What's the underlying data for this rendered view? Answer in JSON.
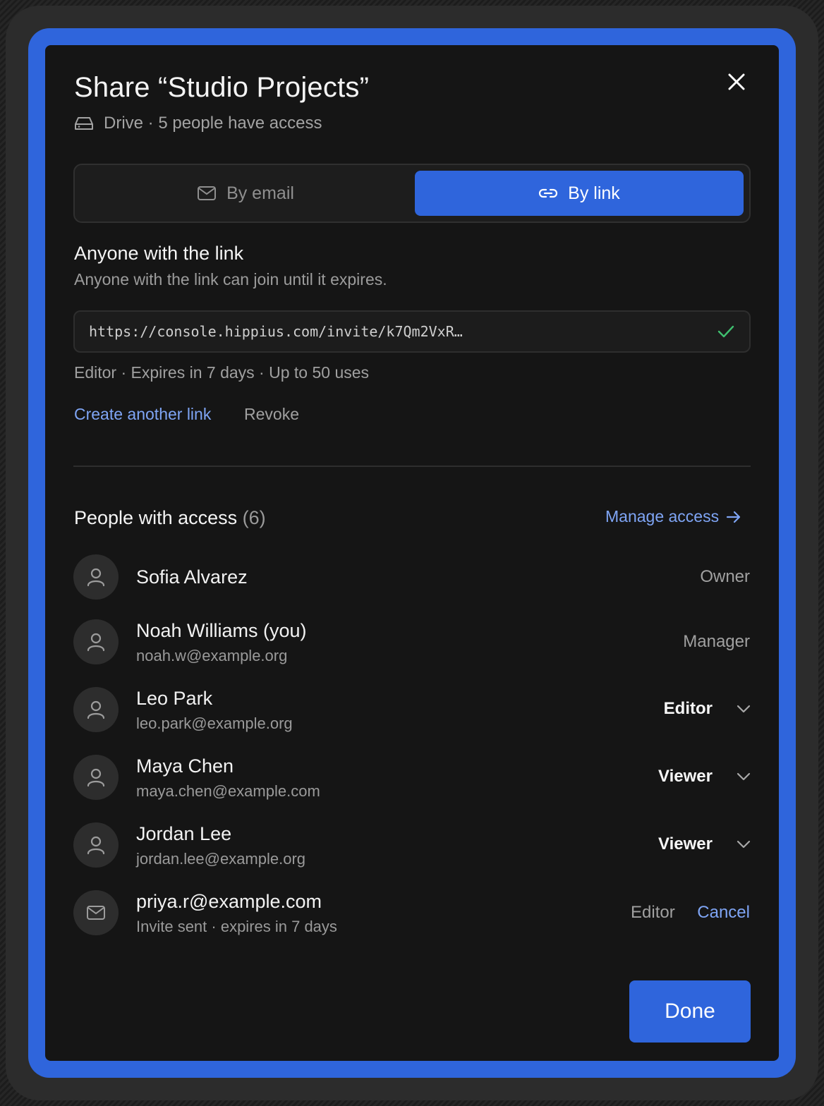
{
  "dialog": {
    "title": "Share “Studio Projects”",
    "subtitle": "Drive · 5 people have access",
    "close_icon": "close-icon",
    "drive_icon": "drive-icon"
  },
  "tabs": [
    {
      "label": "By email",
      "icon": "mail-icon",
      "active": false
    },
    {
      "label": "By link",
      "icon": "link-icon",
      "active": true
    }
  ],
  "link_section": {
    "title": "Anyone with the link",
    "description": "Anyone with the link can join until it expires.",
    "url": "https://console.hippius.com/invite/k7Qm2VxR…",
    "status_icon": "check-icon",
    "meta": "Editor · Expires in 7 days · Up to 50 uses",
    "create_label": "Create another link",
    "revoke_label": "Revoke"
  },
  "people": {
    "title": "People with access",
    "count": "(6)",
    "manage_label": "Manage access",
    "members": [
      {
        "name": "Sofia Alvarez",
        "email": "",
        "role": "Owner",
        "editable": false
      },
      {
        "name": "Noah Williams (you)",
        "email": "noah.w@example.org",
        "role": "Manager",
        "editable": false
      },
      {
        "name": "Leo Park",
        "email": "leo.park@example.org",
        "role": "Editor",
        "editable": true
      },
      {
        "name": "Maya Chen",
        "email": "maya.chen@example.com",
        "role": "Viewer",
        "editable": true
      },
      {
        "name": "Jordan Lee",
        "email": "jordan.lee@example.org",
        "role": "Viewer",
        "editable": true
      }
    ],
    "pending": {
      "email": "priya.r@example.com",
      "status": "Invite sent · expires in 7 days",
      "role": "Editor",
      "cancel_label": "Cancel"
    }
  },
  "footer": {
    "done_label": "Done"
  },
  "colors": {
    "accent": "#2f65dc",
    "link": "#7fa5f5",
    "success": "#3fbf6f",
    "background": "#151515"
  }
}
